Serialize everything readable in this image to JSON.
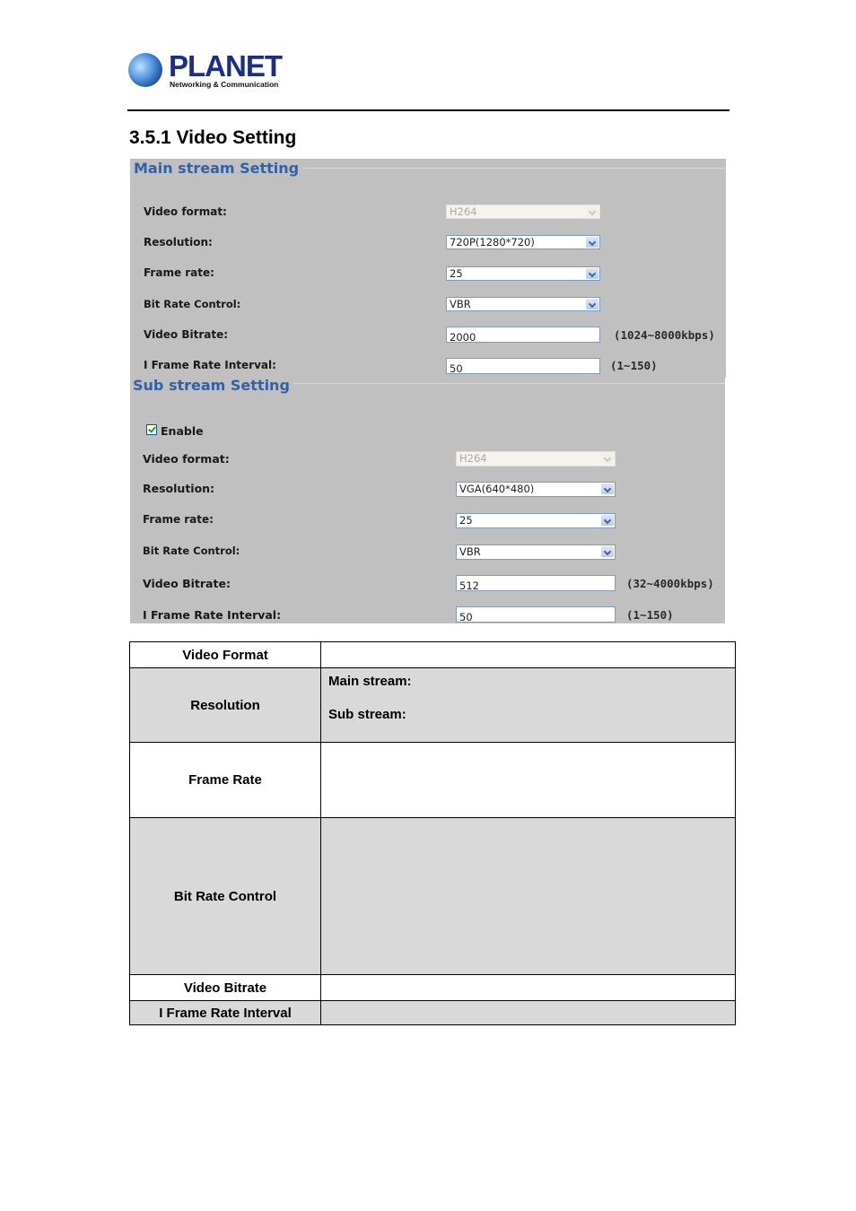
{
  "header": {
    "brand": "PLANET",
    "tagline": "Networking & Communication"
  },
  "section_title": "3.5.1 Video Setting",
  "main_stream": {
    "legend": "Main stream Setting",
    "fields": {
      "video_format": {
        "label": "Video format:",
        "value": "H264",
        "disabled": true
      },
      "resolution": {
        "label": "Resolution:",
        "value": "720P(1280*720)"
      },
      "frame_rate": {
        "label": "Frame rate:",
        "value": "25"
      },
      "bit_rate_control": {
        "label": "Bit Rate Control:",
        "value": "VBR"
      },
      "video_bitrate": {
        "label": "Video Bitrate:",
        "value": "2000",
        "hint": "(1024~8000kbps)"
      },
      "i_frame_interval": {
        "label": "I Frame Rate Interval:",
        "value": "50",
        "hint": "(1~150)"
      }
    }
  },
  "sub_stream": {
    "legend": "Sub stream Setting",
    "enable": {
      "label": "Enable",
      "checked": true
    },
    "fields": {
      "video_format": {
        "label": "Video format:",
        "value": "H264",
        "disabled": true
      },
      "resolution": {
        "label": "Resolution:",
        "value": "VGA(640*480)"
      },
      "frame_rate": {
        "label": "Frame rate:",
        "value": "25"
      },
      "bit_rate_control": {
        "label": "Bit Rate Control:",
        "value": "VBR"
      },
      "video_bitrate": {
        "label": "Video Bitrate:",
        "value": "512",
        "hint": "(32~4000kbps)"
      },
      "i_frame_interval": {
        "label": "I Frame Rate Interval:",
        "value": "50",
        "hint": "(1~150)"
      }
    }
  },
  "description_table": {
    "rows": [
      {
        "key": "Video Format",
        "value": ""
      },
      {
        "key": "Resolution",
        "main_label": "Main stream:",
        "sub_label": "Sub stream:"
      },
      {
        "key": "Frame Rate",
        "value": ""
      },
      {
        "key": "Bit Rate Control",
        "value": ""
      },
      {
        "key": "Video Bitrate",
        "value": ""
      },
      {
        "key": "I Frame Rate Interval",
        "value": ""
      }
    ]
  },
  "colors": {
    "panel_bg": "#bfc0bf",
    "legend_blue": "#3162a8",
    "table_gray": "#d9d9d9"
  }
}
